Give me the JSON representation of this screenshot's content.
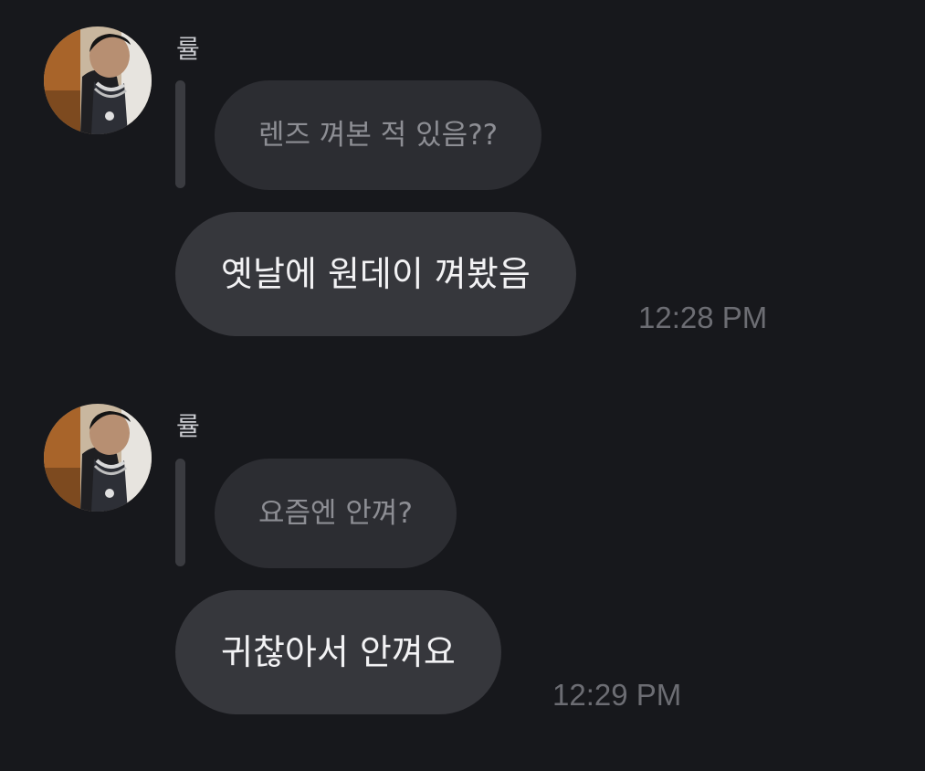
{
  "messages": [
    {
      "sender": "률",
      "reply_text": "렌즈 껴본 적 있음??",
      "text": "옛날에 원데이 껴봤음",
      "time": "12:28 PM"
    },
    {
      "sender": "률",
      "reply_text": "요즘엔 안껴?",
      "text": "귀찮아서 안껴요",
      "time": "12:29 PM"
    }
  ],
  "colors": {
    "background": "#17181c",
    "bubble": "#36373c",
    "reply_bubble": "#2c2d32",
    "reply_bar": "#3a3b40",
    "timestamp": "#6c6d73"
  },
  "icons": {
    "avatar": "profile-photo"
  }
}
